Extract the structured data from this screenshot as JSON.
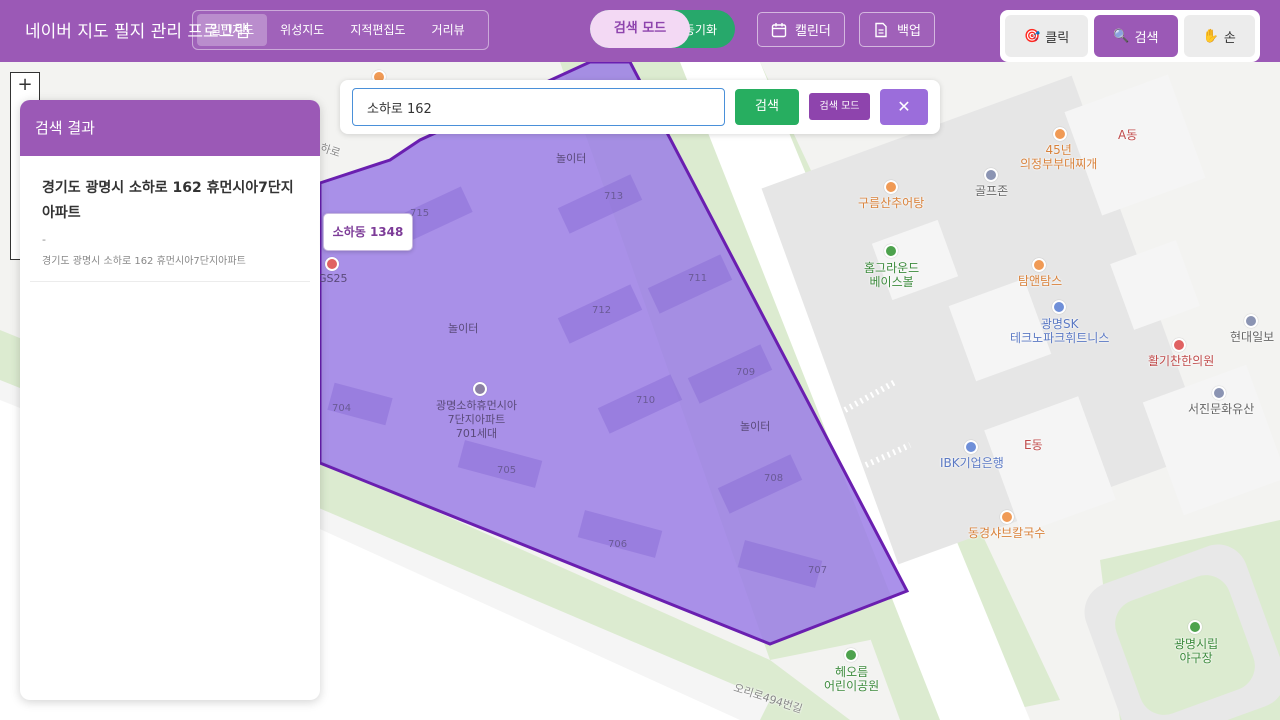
{
  "app": {
    "title": "네이버 지도 필지 관리 프로그램"
  },
  "map_tabs": [
    {
      "label": "일반지도"
    },
    {
      "label": "위성지도"
    },
    {
      "label": "지적편집도"
    },
    {
      "label": "거리뷰"
    }
  ],
  "mode": {
    "active_label": "검색 모드",
    "sync_label": "동기화"
  },
  "toolbar": {
    "calendar_label": "캘린더",
    "backup_label": "백업"
  },
  "tools": [
    {
      "icon": "🎯",
      "label": "클릭"
    },
    {
      "icon": "🔍",
      "label": "검색"
    },
    {
      "icon": "✋",
      "label": "손"
    }
  ],
  "search": {
    "value": "소하로 162",
    "button_label": "검색",
    "mode_badge": "검색 모드",
    "close_label": "✕"
  },
  "results": {
    "header": "검색 결과",
    "items": [
      {
        "title": "경기도 광명시 소하로 162 휴먼시아7단지아파트",
        "subtitle": "-",
        "address": "경기도 광명시 소하로 162 휴먼시아7단지아파트"
      }
    ]
  },
  "parcel": {
    "label": "소하동 1348"
  },
  "map": {
    "colors": {
      "parcel_fill": "#9b7ee6",
      "parcel_stroke": "#6a1fb0",
      "park": "#dcebd0"
    },
    "labels": [
      {
        "text": "놀이터"
      },
      {
        "text": "놀이터"
      },
      {
        "text": "놀이터"
      },
      {
        "text": "713"
      },
      {
        "text": "715"
      },
      {
        "text": "711"
      },
      {
        "text": "712"
      },
      {
        "text": "709"
      },
      {
        "text": "710"
      },
      {
        "text": "708"
      },
      {
        "text": "704"
      },
      {
        "text": "705"
      },
      {
        "text": "706"
      },
      {
        "text": "707"
      },
      {
        "text": "광명소하휴먼시아\n7단지아파트\n701세대"
      },
      {
        "text": "GS25"
      },
      {
        "text": "45년\n의정부부대찌개"
      },
      {
        "text": "A동"
      },
      {
        "text": "골프존"
      },
      {
        "text": "구름산추어탕"
      },
      {
        "text": "홈그라운드\n베이스볼"
      },
      {
        "text": "탐앤탐스"
      },
      {
        "text": "광명SK\n테크노파크휘트니스"
      },
      {
        "text": "현대일보"
      },
      {
        "text": "활기찬한의원"
      },
      {
        "text": "서진문화유산"
      },
      {
        "text": "IBK기업은행"
      },
      {
        "text": "E동"
      },
      {
        "text": "동경샤브칼국수"
      },
      {
        "text": "헤오름\n어린이공원"
      },
      {
        "text": "광명시립\n야구장"
      },
      {
        "text": "오리로494번길"
      },
      {
        "text": "하로"
      }
    ],
    "zoom": {
      "plus": "+"
    }
  }
}
